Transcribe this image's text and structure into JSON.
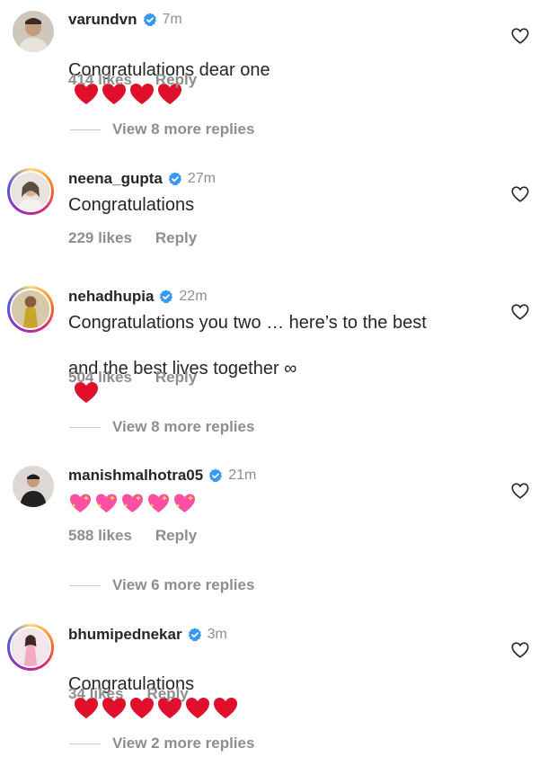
{
  "comments": [
    {
      "username": "varundvn",
      "time": "7m",
      "text": "Congratulations dear one",
      "heart_count": 4,
      "likes": "414 likes",
      "reply": "Reply",
      "view_more": "View 8 more replies"
    },
    {
      "username": "neena_gupta",
      "time": "27m",
      "text": "Congratulations",
      "heart_count": 0,
      "likes": "229 likes",
      "reply": "Reply"
    },
    {
      "username": "nehadhupia",
      "time": "22m",
      "text_line1": "Congratulations you two … here’s to the best",
      "text_line2": "and the best lives together ∞",
      "heart_count": 1,
      "likes": "504 likes",
      "reply": "Reply",
      "view_more": "View 8 more replies"
    },
    {
      "username": "manishmalhotra05",
      "time": "21m",
      "sparkle_count": 5,
      "likes": "588 likes",
      "reply": "Reply",
      "view_more": "View 6 more replies"
    },
    {
      "username": "bhumipednekar",
      "time": "3m",
      "text": "Congratulations",
      "heart_count": 6,
      "likes": "34 likes",
      "reply": "Reply",
      "view_more": "View 2 more replies"
    }
  ],
  "colors": {
    "verified": "#3897f0",
    "heart": "#e0102d",
    "muted": "#8e8e8e"
  },
  "icons": {
    "verified": "verified-badge-icon",
    "like": "heart-outline-icon"
  }
}
